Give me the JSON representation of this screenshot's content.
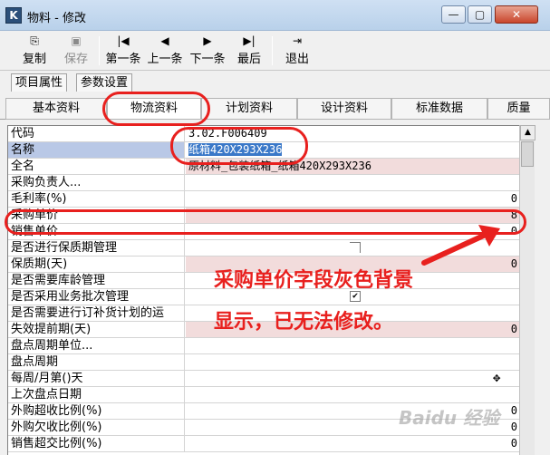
{
  "window": {
    "title": "物料 - 修改",
    "app_icon": "K",
    "min_glyph": "—",
    "max_glyph": "▢",
    "close_glyph": "✕"
  },
  "toolbar": {
    "copy": "复制",
    "save": "保存",
    "first": "第一条",
    "prev": "上一条",
    "next": "下一条",
    "last": "最后",
    "exit": "退出",
    "copy_icon": "⎘",
    "save_icon": "▣",
    "first_icon": "|◀",
    "prev_icon": "◀",
    "next_icon": "▶",
    "last_icon": "▶|",
    "exit_icon": "⇥"
  },
  "property_tabs": [
    "项目属性",
    "参数设置"
  ],
  "section_tabs": [
    "基本资料",
    "物流资料",
    "计划资料",
    "设计资料",
    "标准数据",
    "质量"
  ],
  "grid": {
    "rows": [
      {
        "label": "代码",
        "value": "3.02.F006409"
      },
      {
        "label": "名称",
        "value": "纸箱420X293X236"
      },
      {
        "label": "全名",
        "value": "原材料_包装纸箱_纸箱420X293X236"
      },
      {
        "label": "采购负责人...",
        "value": ""
      },
      {
        "label": "毛利率(%)",
        "value": "0"
      },
      {
        "label": "采购单价",
        "value": "8"
      },
      {
        "label": "销售单价",
        "value": "0"
      },
      {
        "label": "是否进行保质期管理",
        "value": ""
      },
      {
        "label": "保质期(天)",
        "value": "0"
      },
      {
        "label": "是否需要库龄管理",
        "value": ""
      },
      {
        "label": "是否采用业务批次管理",
        "value": "✔"
      },
      {
        "label": "是否需要进行订补货计划的运",
        "value": ""
      },
      {
        "label": "失效提前期(天)",
        "value": "0"
      },
      {
        "label": "盘点周期单位...",
        "value": ""
      },
      {
        "label": "盘点周期",
        "value": ""
      },
      {
        "label": "每周/月第()天",
        "value": "✥"
      },
      {
        "label": "上次盘点日期",
        "value": ""
      },
      {
        "label": "外购超收比例(%)",
        "value": "0"
      },
      {
        "label": "外购欠收比例(%)",
        "value": "0"
      },
      {
        "label": "销售超交比例(%)",
        "value": "0"
      }
    ]
  },
  "scrollbar": {
    "up_glyph": "▲"
  },
  "annotation": {
    "line1": "采购单价字段灰色背景",
    "line2": "显示，已无法修改。"
  },
  "watermark": "Baidu 经验",
  "colors": {
    "annotation_red": "#e8201e",
    "readonly_pink": "#f2dcdc",
    "highlight_blue": "#b9c8e6",
    "selection_blue": "#3a78c8"
  }
}
